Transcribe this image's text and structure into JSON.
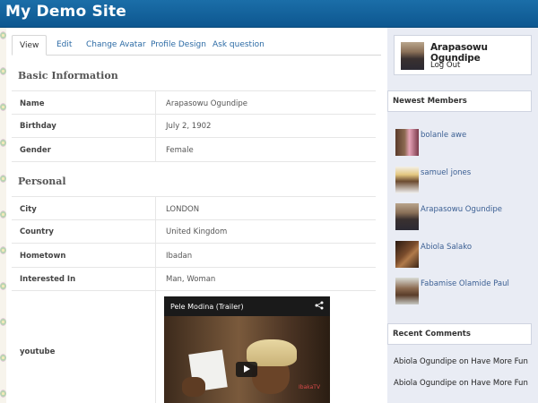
{
  "header": {
    "site_title": "My Demo Site"
  },
  "tabs": [
    {
      "label": "View",
      "active": true
    },
    {
      "label": "Edit",
      "active": false
    },
    {
      "label": "Change Avatar",
      "active": false
    },
    {
      "label": "Profile Design",
      "active": false
    },
    {
      "label": "Ask question",
      "active": false
    }
  ],
  "basic": {
    "title": "Basic Information",
    "name_label": "Name",
    "name_value": "Arapasowu Ogundipe",
    "birthday_label": "Birthday",
    "birthday_value": "July 2, 1902",
    "gender_label": "Gender",
    "gender_value": "Female"
  },
  "personal": {
    "title": "Personal",
    "city_label": "City",
    "city_value": "LONDON",
    "country_label": "Country",
    "country_value": "United Kingdom",
    "hometown_label": "Hometown",
    "hometown_value": "Ibadan",
    "interested_label": "Interested In",
    "interested_value": "Man, Woman",
    "youtube_label": "youtube"
  },
  "video": {
    "title": "Pele Modina (Trailer)",
    "watermark": "IbakaTV"
  },
  "user_box": {
    "name": "Arapasowu Ogundipe",
    "logout": "Log Out"
  },
  "newest_members": {
    "title": "Newest Members",
    "items": [
      {
        "name": "bolanle awe"
      },
      {
        "name": "samuel jones"
      },
      {
        "name": "Arapasowu Ogundipe"
      },
      {
        "name": "Abiola Salako"
      },
      {
        "name": "Fabamise Olamide Paul"
      }
    ]
  },
  "recent_comments": {
    "title": "Recent Comments",
    "items": [
      {
        "author": "Abiola Ogundipe",
        "on": "on",
        "post": "Have More Fun"
      },
      {
        "author": "Abiola Ogundipe",
        "on": "on",
        "post": "Have More Fun"
      }
    ]
  },
  "colors": {
    "header_blue": "#0d5790",
    "link_blue": "#2c6ba5",
    "sidebar_bg": "#e9ecf4"
  }
}
